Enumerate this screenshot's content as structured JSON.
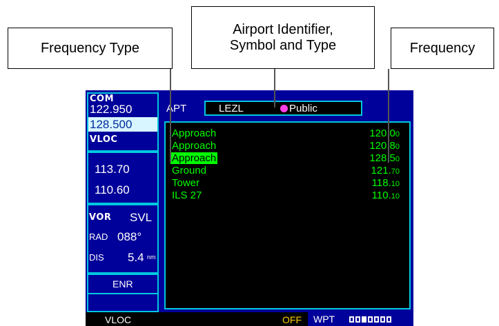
{
  "callouts": {
    "frequency_type": "Frequency Type",
    "airport_identifier_line1": "Airport Identifier,",
    "airport_identifier_line2": "Symbol and Type",
    "frequency": "Frequency"
  },
  "sidebar": {
    "com_label": "COM",
    "com_active": "122.950",
    "com_standby": "128.500",
    "vloc_label": "VLOC",
    "vloc_active": "113.70",
    "vloc_standby": "110.60",
    "vor_label": "VOR",
    "vor_id": "SVL",
    "rad_label": "RAD",
    "rad_value": "088°",
    "dis_label": "DIS",
    "dis_value": "5.4",
    "dis_unit": "nm",
    "mode": "ENR"
  },
  "page": {
    "apt_label": "APT",
    "identifier": "LEZL",
    "airport_type": "Public",
    "symbol_color": "#ff40e6"
  },
  "frequencies": [
    {
      "type": "Approach",
      "freq_main": "120.0",
      "freq_dec": "0",
      "selected": false
    },
    {
      "type": "Approach",
      "freq_main": "120.8",
      "freq_dec": "0",
      "selected": false
    },
    {
      "type": "Approach",
      "freq_main": "128.5",
      "freq_dec": "0",
      "selected": true
    },
    {
      "type": "Ground",
      "freq_main": "121.",
      "freq_dec": "70",
      "selected": false
    },
    {
      "type": "Tower",
      "freq_main": "118.",
      "freq_dec": "10",
      "selected": false
    },
    {
      "type": "ILS 27",
      "freq_main": "110.",
      "freq_dec": "10",
      "selected": false
    }
  ],
  "status_bar": {
    "vloc": "VLOC",
    "off": "OFF",
    "wpt": "WPT",
    "page_total": 7,
    "page_active": 3
  }
}
